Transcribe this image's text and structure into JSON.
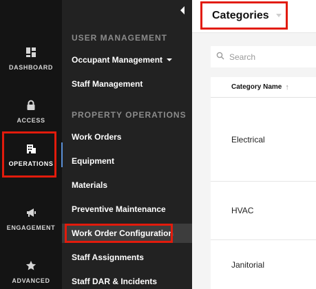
{
  "rail": {
    "items": [
      {
        "label": "DASHBOARD",
        "icon": "dashboard-icon"
      },
      {
        "label": "ACCESS",
        "icon": "lock-icon"
      },
      {
        "label": "OPERATIONS",
        "icon": "building-icon"
      },
      {
        "label": "ENGAGEMENT",
        "icon": "megaphone-icon"
      },
      {
        "label": "ADVANCED",
        "icon": "star-icon"
      }
    ],
    "active": "OPERATIONS"
  },
  "subnav": {
    "sections": [
      {
        "heading": "USER MANAGEMENT",
        "items": [
          "Occupant Management",
          "Staff Management"
        ]
      },
      {
        "heading": "PROPERTY OPERATIONS",
        "items": [
          "Work Orders",
          "Equipment",
          "Materials",
          "Preventive Maintenance",
          "Work Order Configuration",
          "Staff Assignments",
          "Staff DAR & Incidents"
        ]
      }
    ],
    "active_item": "Work Order Configuration"
  },
  "main": {
    "title": "Categories",
    "search": {
      "placeholder": "Search"
    },
    "table": {
      "columns": [
        "Category Name"
      ],
      "rows": [
        "Electrical",
        "HVAC",
        "Janitorial"
      ]
    }
  },
  "colors": {
    "highlight": "#e21b0c",
    "rail_bg": "#141414",
    "subnav_bg": "#222222"
  }
}
